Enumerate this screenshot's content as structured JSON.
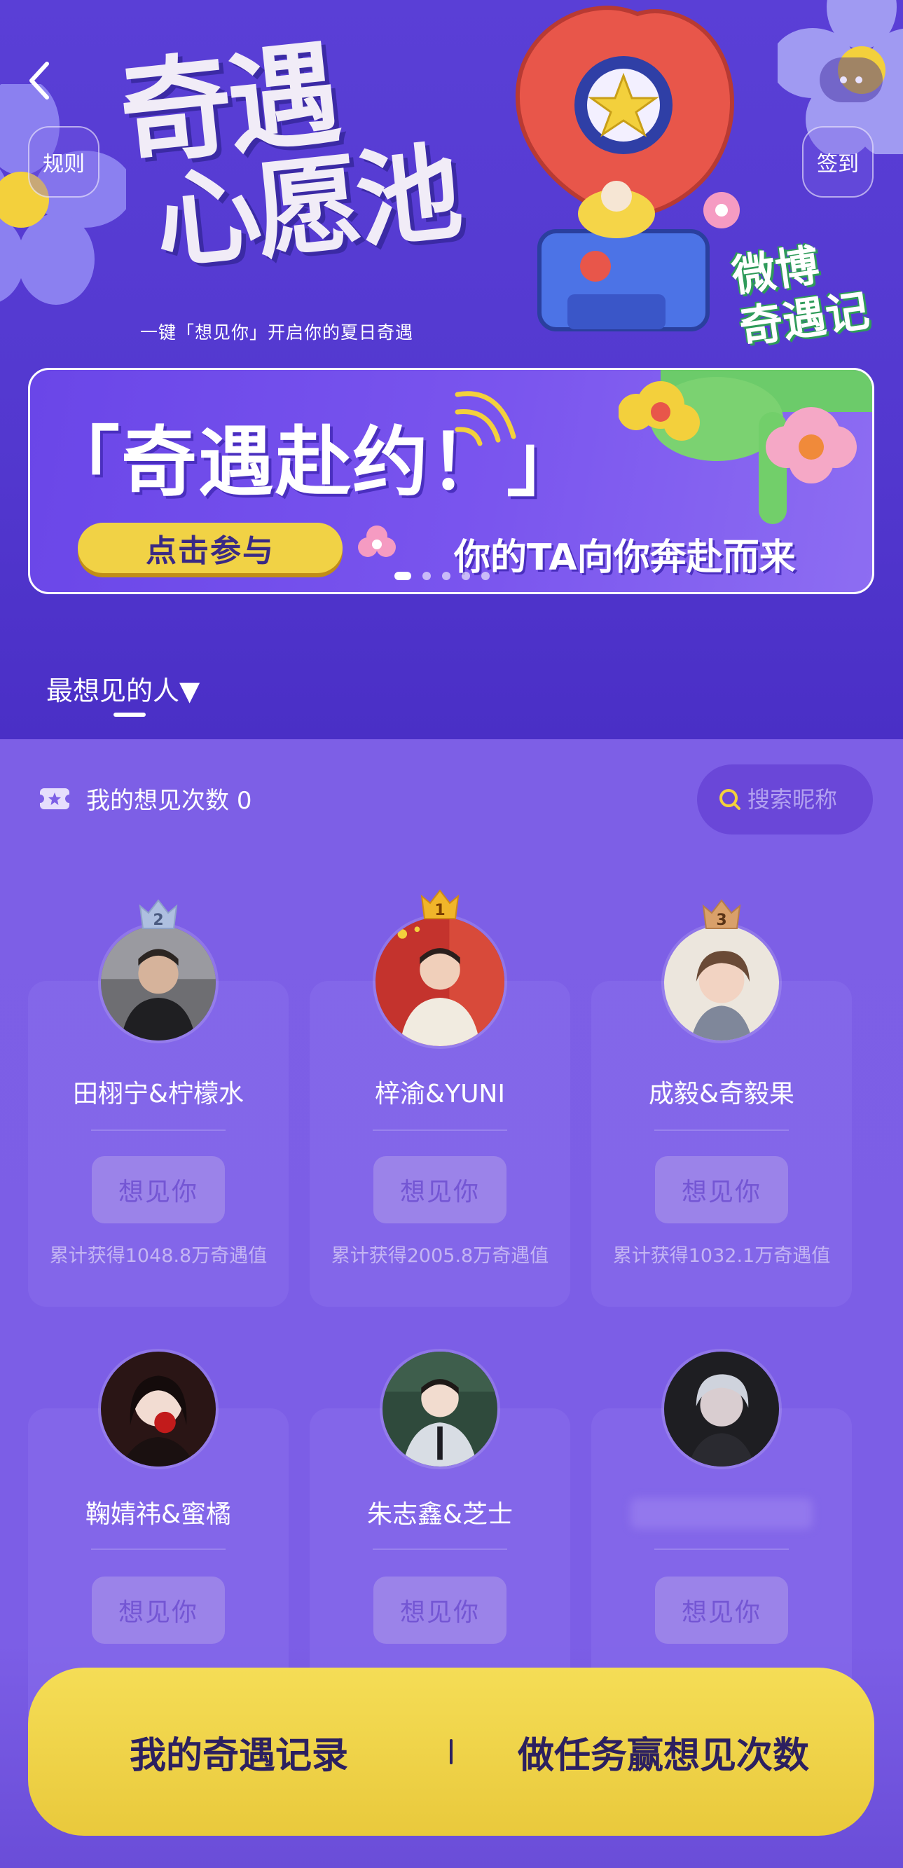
{
  "hero": {
    "title_line1": "奇遇",
    "title_line2": "心愿池",
    "subtitle": "一键「想见你」开启你的夏日奇遇",
    "brand_line1": "微博",
    "brand_line2": "奇遇记",
    "rules_label": "规则",
    "checkin_label": "签到",
    "back_icon": "chevron-left-icon",
    "more_icon": "more-dots-icon"
  },
  "banner": {
    "title": "「奇遇赴约！」",
    "cta_label": "点击参与",
    "slogan": "你的TA向你奔赴而来",
    "slide_count": 5,
    "active_slide": 0
  },
  "tab": {
    "label": "最想见的人▼"
  },
  "stats": {
    "label": "我的想见次数",
    "count": "0",
    "search_placeholder": "搜索昵称"
  },
  "cards": [
    {
      "rank": "2",
      "name": "田栩宁&柠檬水",
      "button": "想见你",
      "value": "累计获得1048.8万奇遇值"
    },
    {
      "rank": "1",
      "name": "梓渝&YUNI",
      "button": "想见你",
      "value": "累计获得2005.8万奇遇值"
    },
    {
      "rank": "3",
      "name": "成毅&奇毅果",
      "button": "想见你",
      "value": "累计获得1032.1万奇遇值"
    },
    {
      "rank": "",
      "name": "鞠婧祎&蜜橘",
      "button": "想见你",
      "value": ""
    },
    {
      "rank": "",
      "name": "朱志鑫&芝士",
      "button": "想见你",
      "value": ""
    },
    {
      "rank": "",
      "name": "",
      "button": "想见你",
      "value": ""
    }
  ],
  "bottom_bar": {
    "left_label": "我的奇遇记录",
    "right_label": "做任务赢想见次数"
  },
  "colors": {
    "hero_bg": "#5a3fd6",
    "content_bg": "#7d5fe6",
    "accent_yellow": "#f1d245",
    "button_fill": "#9b83e9",
    "crown_gold": "#f0b52a",
    "crown_silver": "#aebfe0",
    "crown_bronze": "#d9a06a"
  }
}
